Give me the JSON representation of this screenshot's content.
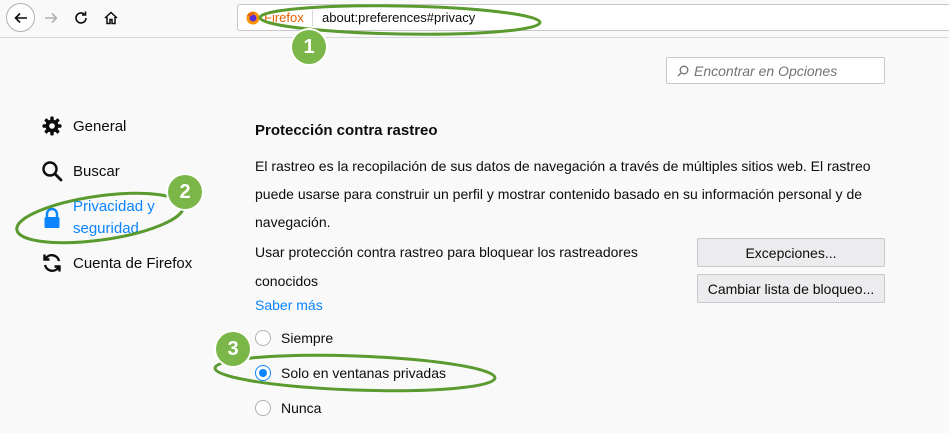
{
  "browser": {
    "identity_label": "Firefox",
    "url": "about:preferences#privacy"
  },
  "search": {
    "placeholder": "Encontrar en Opciones"
  },
  "sidebar": {
    "items": [
      {
        "label": "General",
        "icon": "gear-icon"
      },
      {
        "label": "Buscar",
        "icon": "search-icon"
      },
      {
        "label_line1": "Privacidad y",
        "label_line2": "seguridad",
        "icon": "lock-icon"
      },
      {
        "label": "Cuenta de Firefox",
        "icon": "sync-icon"
      }
    ]
  },
  "main": {
    "title": "Protección contra rastreo",
    "description_lines": [
      "El rastreo es la recopilación de sus datos de navegación a través de múltiples sitios web. El rastreo",
      "puede usarse para construir un perfil y mostrar contenido basado en su información personal y de",
      "navegación."
    ],
    "use_text_lines": [
      "Usar protección contra rastreo para bloquear los rastreadores",
      "conocidos"
    ],
    "learn_more": "Saber más",
    "exceptions_button": "Excepciones...",
    "change_list_button": "Cambiar lista de bloqueo...",
    "options": [
      {
        "label": "Siempre",
        "checked": false
      },
      {
        "label": "Solo en ventanas privadas",
        "checked": true
      },
      {
        "label": "Nunca",
        "checked": false
      }
    ]
  },
  "annotations": {
    "badge1": "1",
    "badge2": "2",
    "badge3": "3",
    "color": "#7ab648"
  },
  "colors": {
    "accent": "#0a84ff",
    "firefox_orange": "#e66000"
  }
}
